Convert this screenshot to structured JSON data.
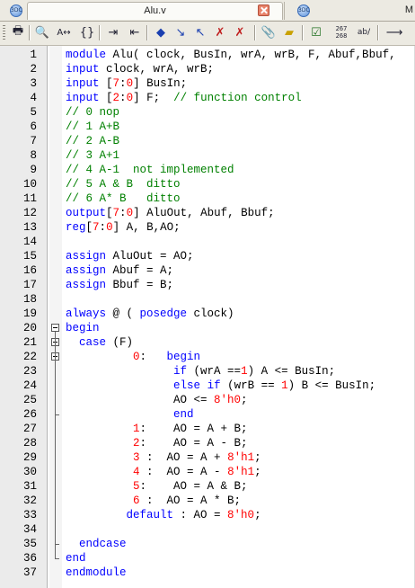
{
  "tabs": {
    "active_title": "Alu.v",
    "right_partial": "M",
    "doc_icon_glyph": "3DC"
  },
  "toolbar": {
    "icons": [
      "print-icon",
      "find-icon",
      "replace-icon",
      "brace-match-icon",
      "indent-icon",
      "outdent-icon",
      "bookmark-icon",
      "next-bookmark-icon",
      "prev-bookmark-icon",
      "clear-bookmark-icon",
      "clear-all-bookmarks-icon",
      "attach-icon",
      "highlighter-icon",
      "checklist-icon",
      "line-number-icon",
      "word-wrap-icon",
      "run-icon"
    ],
    "line_num_label_top": "267",
    "line_num_label_bottom": "268",
    "wrap_label": "ab/"
  },
  "editor": {
    "lines": [
      {
        "n": "1",
        "html": "<span class=\"kw\">module</span> Alu( clock, BusIn, wrA, wrB, F, Abuf,Bbuf,"
      },
      {
        "n": "2",
        "html": "<span class=\"kw\">input</span> clock, wrA, wrB;"
      },
      {
        "n": "3",
        "html": "<span class=\"kw\">input</span> [<span class=\"nm\">7</span>:<span class=\"nm\">0</span>] BusIn;"
      },
      {
        "n": "4",
        "html": "<span class=\"kw\">input</span> [<span class=\"nm\">2</span>:<span class=\"nm\">0</span>] F;  <span class=\"cm\">// function control</span>"
      },
      {
        "n": "5",
        "html": "<span class=\"cm\">// 0 nop</span>"
      },
      {
        "n": "6",
        "html": "<span class=\"cm\">// 1 A+B</span>"
      },
      {
        "n": "7",
        "html": "<span class=\"cm\">// 2 A-B</span>"
      },
      {
        "n": "8",
        "html": "<span class=\"cm\">// 3 A+1</span>"
      },
      {
        "n": "9",
        "html": "<span class=\"cm\">// 4 A-1  not implemented</span>"
      },
      {
        "n": "10",
        "html": "<span class=\"cm\">// 5 A &amp; B  ditto</span>"
      },
      {
        "n": "11",
        "html": "<span class=\"cm\">// 6 A* B   ditto</span>"
      },
      {
        "n": "12",
        "html": "<span class=\"kw\">output</span>[<span class=\"nm\">7</span>:<span class=\"nm\">0</span>] AluOut, Abuf, Bbuf;"
      },
      {
        "n": "13",
        "html": "<span class=\"kw\">reg</span>[<span class=\"nm\">7</span>:<span class=\"nm\">0</span>] A, B,AO;"
      },
      {
        "n": "14",
        "html": ""
      },
      {
        "n": "15",
        "html": "<span class=\"kw\">assign</span> AluOut = AO;"
      },
      {
        "n": "16",
        "html": "<span class=\"kw\">assign</span> Abuf = A;"
      },
      {
        "n": "17",
        "html": "<span class=\"kw\">assign</span> Bbuf = B;"
      },
      {
        "n": "18",
        "html": ""
      },
      {
        "n": "19",
        "html": "<span class=\"kw\">always</span> @ ( <span class=\"kw\">posedge</span> clock)"
      },
      {
        "n": "20",
        "html": "<span class=\"kw\">begin</span>"
      },
      {
        "n": "21",
        "html": "  <span class=\"kw\">case</span> (F)"
      },
      {
        "n": "22",
        "html": "          <span class=\"nm\">0</span>:   <span class=\"kw\">begin</span>"
      },
      {
        "n": "23",
        "html": "                <span class=\"kw\">if</span> (wrA ==<span class=\"nm\">1</span>) A &lt;= BusIn;"
      },
      {
        "n": "24",
        "html": "                <span class=\"kw\">else</span> <span class=\"kw\">if</span> (wrB == <span class=\"nm\">1</span>) B &lt;= BusIn;"
      },
      {
        "n": "25",
        "html": "                AO &lt;= <span class=\"nm\">8'h0</span>;"
      },
      {
        "n": "26",
        "html": "                <span class=\"kw\">end</span>"
      },
      {
        "n": "27",
        "html": "          <span class=\"nm\">1</span>:    AO = A + B;"
      },
      {
        "n": "28",
        "html": "          <span class=\"nm\">2</span>:    AO = A - B;"
      },
      {
        "n": "29",
        "html": "          <span class=\"nm\">3</span> :  AO = A + <span class=\"nm\">8'h1</span>;"
      },
      {
        "n": "30",
        "html": "          <span class=\"nm\">4</span> :  AO = A - <span class=\"nm\">8'h1</span>;"
      },
      {
        "n": "31",
        "html": "          <span class=\"nm\">5</span>:    AO = A &amp; B;"
      },
      {
        "n": "32",
        "html": "          <span class=\"nm\">6</span> :  AO = A * B;"
      },
      {
        "n": "33",
        "html": "         <span class=\"kw\">default</span> : AO = <span class=\"nm\">8'h0</span>;"
      },
      {
        "n": "34",
        "html": ""
      },
      {
        "n": "35",
        "html": "  <span class=\"kw\">endcase</span>"
      },
      {
        "n": "36",
        "html": "<span class=\"kw\">end</span>"
      },
      {
        "n": "37",
        "html": "<span class=\"kw\">endmodule</span>"
      }
    ],
    "fold_markers": [
      20,
      21,
      22
    ]
  },
  "colors": {
    "keyword": "#0000ff",
    "comment": "#008000",
    "number": "#ff0000",
    "gutter_bg": "#ebebeb"
  }
}
